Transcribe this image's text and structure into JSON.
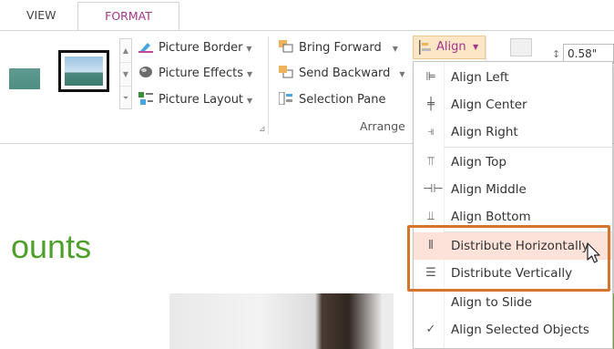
{
  "tabs": {
    "view": "VIEW",
    "format": "FORMAT"
  },
  "picture_styles": {
    "border": "Picture Border",
    "effects": "Picture Effects",
    "layout": "Picture Layout"
  },
  "arrange": {
    "bring_forward": "Bring Forward",
    "send_backward": "Send Backward",
    "selection_pane": "Selection Pane",
    "group_label": "Arrange",
    "align_button": "Align"
  },
  "size": {
    "height_value": "0.58\""
  },
  "slide": {
    "heading": "ounts"
  },
  "align_menu": {
    "items": [
      {
        "label": "Align Left",
        "icon": "align-left-icon",
        "glyph": "⊫"
      },
      {
        "label": "Align Center",
        "icon": "align-center-icon",
        "glyph": "╪"
      },
      {
        "label": "Align Right",
        "icon": "align-right-icon",
        "glyph": "⫣"
      },
      {
        "label": "Align Top",
        "icon": "align-top-icon",
        "glyph": "⫪"
      },
      {
        "label": "Align Middle",
        "icon": "align-middle-icon",
        "glyph": "⊣⊢"
      },
      {
        "label": "Align Bottom",
        "icon": "align-bottom-icon",
        "glyph": "⫫"
      },
      {
        "label": "Distribute Horizontally",
        "icon": "distribute-horizontally-icon",
        "glyph": "⫴"
      },
      {
        "label": "Distribute Vertically",
        "icon": "distribute-vertically-icon",
        "glyph": "☰"
      },
      {
        "label": "Align to Slide",
        "icon": "",
        "glyph": ""
      },
      {
        "label": "Align Selected Objects",
        "icon": "check-icon",
        "glyph": "✓"
      }
    ],
    "hovered": "Distribute Horizontally"
  },
  "colors": {
    "accent": "#a3358b",
    "highlight": "#fde2da",
    "callout": "#d4752e",
    "slide_green": "#4fa02b"
  }
}
